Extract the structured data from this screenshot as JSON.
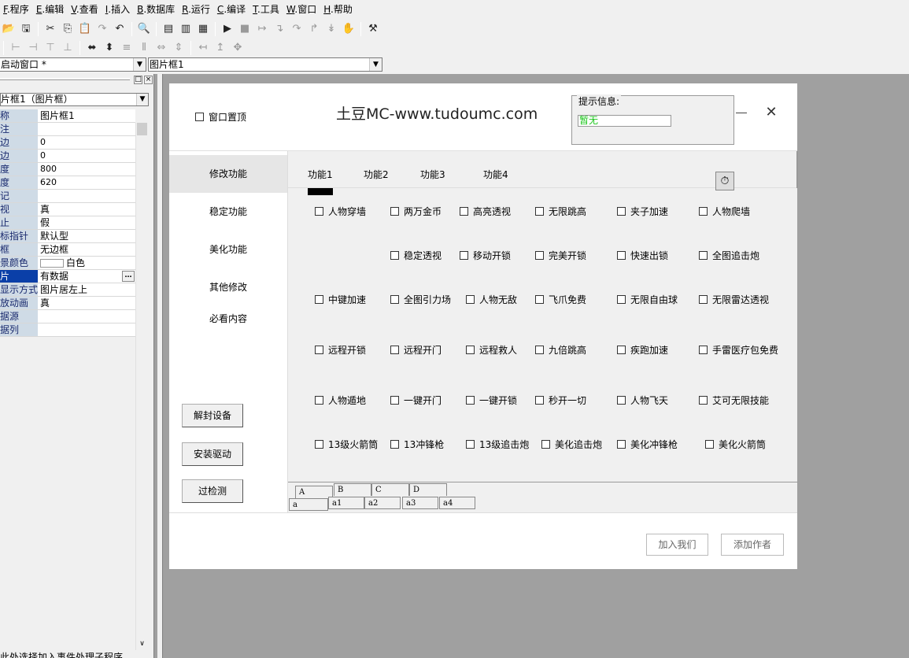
{
  "menu": [
    {
      "acc": "F",
      "label": ".程序"
    },
    {
      "acc": "E",
      "label": ".编辑"
    },
    {
      "acc": "V",
      "label": ".查看"
    },
    {
      "acc": "I",
      "label": ".插入"
    },
    {
      "acc": "B",
      "label": ".数据库"
    },
    {
      "acc": "R",
      "label": ".运行"
    },
    {
      "acc": "C",
      "label": ".编译"
    },
    {
      "acc": "T",
      "label": ".工具"
    },
    {
      "acc": "W",
      "label": ".窗口"
    },
    {
      "acc": "H",
      "label": ".帮助"
    }
  ],
  "combos": {
    "window_select": "启动窗口 *",
    "component_select": "图片框1"
  },
  "property_panel": {
    "object_select": "片框1（图片框）",
    "rows": [
      {
        "name": "称",
        "value": "图片框1"
      },
      {
        "name": "注",
        "value": ""
      },
      {
        "name": "边",
        "value": "0"
      },
      {
        "name": "边",
        "value": "0"
      },
      {
        "name": "度",
        "value": "800"
      },
      {
        "name": "度",
        "value": "620"
      },
      {
        "name": "记",
        "value": ""
      },
      {
        "name": "视",
        "value": "真"
      },
      {
        "name": "止",
        "value": "假"
      },
      {
        "name": "标指针",
        "value": "默认型"
      },
      {
        "name": "框",
        "value": "无边框"
      },
      {
        "name": "景颜色",
        "value": "白色"
      },
      {
        "name": "片",
        "value": "有数据"
      },
      {
        "name": "显示方式",
        "value": "图片居左上"
      },
      {
        "name": "放动画",
        "value": "真"
      },
      {
        "name": "据源",
        "value": ""
      },
      {
        "name": "据列",
        "value": ""
      }
    ],
    "description": "此处选择加入事件处理子程序"
  },
  "form": {
    "pin_top_label": "窗口置顶",
    "title": "土豆MC-www.tudoumc.com",
    "hint_label": "提示信息:",
    "hint_value": "暂无",
    "nav": [
      "修改功能",
      "稳定功能",
      "美化功能",
      "其他修改",
      "必看内容"
    ],
    "side_buttons": [
      "解封设备",
      "安装驱动",
      "过检测"
    ],
    "func_tabs": [
      "功能1",
      "功能2",
      "功能3",
      "功能4"
    ],
    "features": [
      [
        "人物穿墙",
        "两万金币",
        "高亮透视",
        "无限跳高",
        "夹子加速",
        "人物爬墙"
      ],
      [
        "",
        "稳定透视",
        "移动开锁",
        "完美开锁",
        "快速出锁",
        "全图追击炮"
      ],
      [
        "中键加速",
        "全图引力场",
        "人物无敌",
        "飞爪免费",
        "无限自由球",
        "无限雷达透视"
      ],
      [
        "远程开锁",
        "远程开门",
        "远程救人",
        "九倍跳高",
        "疾跑加速",
        "手雷医疗包免费"
      ],
      [
        "人物遁地",
        "一键开门",
        "一键开锁",
        "秒开一切",
        "人物飞天",
        "艾可无限技能"
      ],
      [
        "13级火箭筒",
        "13冲锋枪",
        "13级追击炮",
        "美化追击炮",
        "美化冲锋枪",
        "美化火箭筒"
      ]
    ],
    "bottom_tabs_row1": [
      "A",
      "B",
      "C",
      "D"
    ],
    "bottom_tabs_row2": [
      "a",
      "a1",
      "a2",
      "a3",
      "a4"
    ],
    "footer_buttons": [
      "加入我们",
      "添加作者"
    ]
  }
}
